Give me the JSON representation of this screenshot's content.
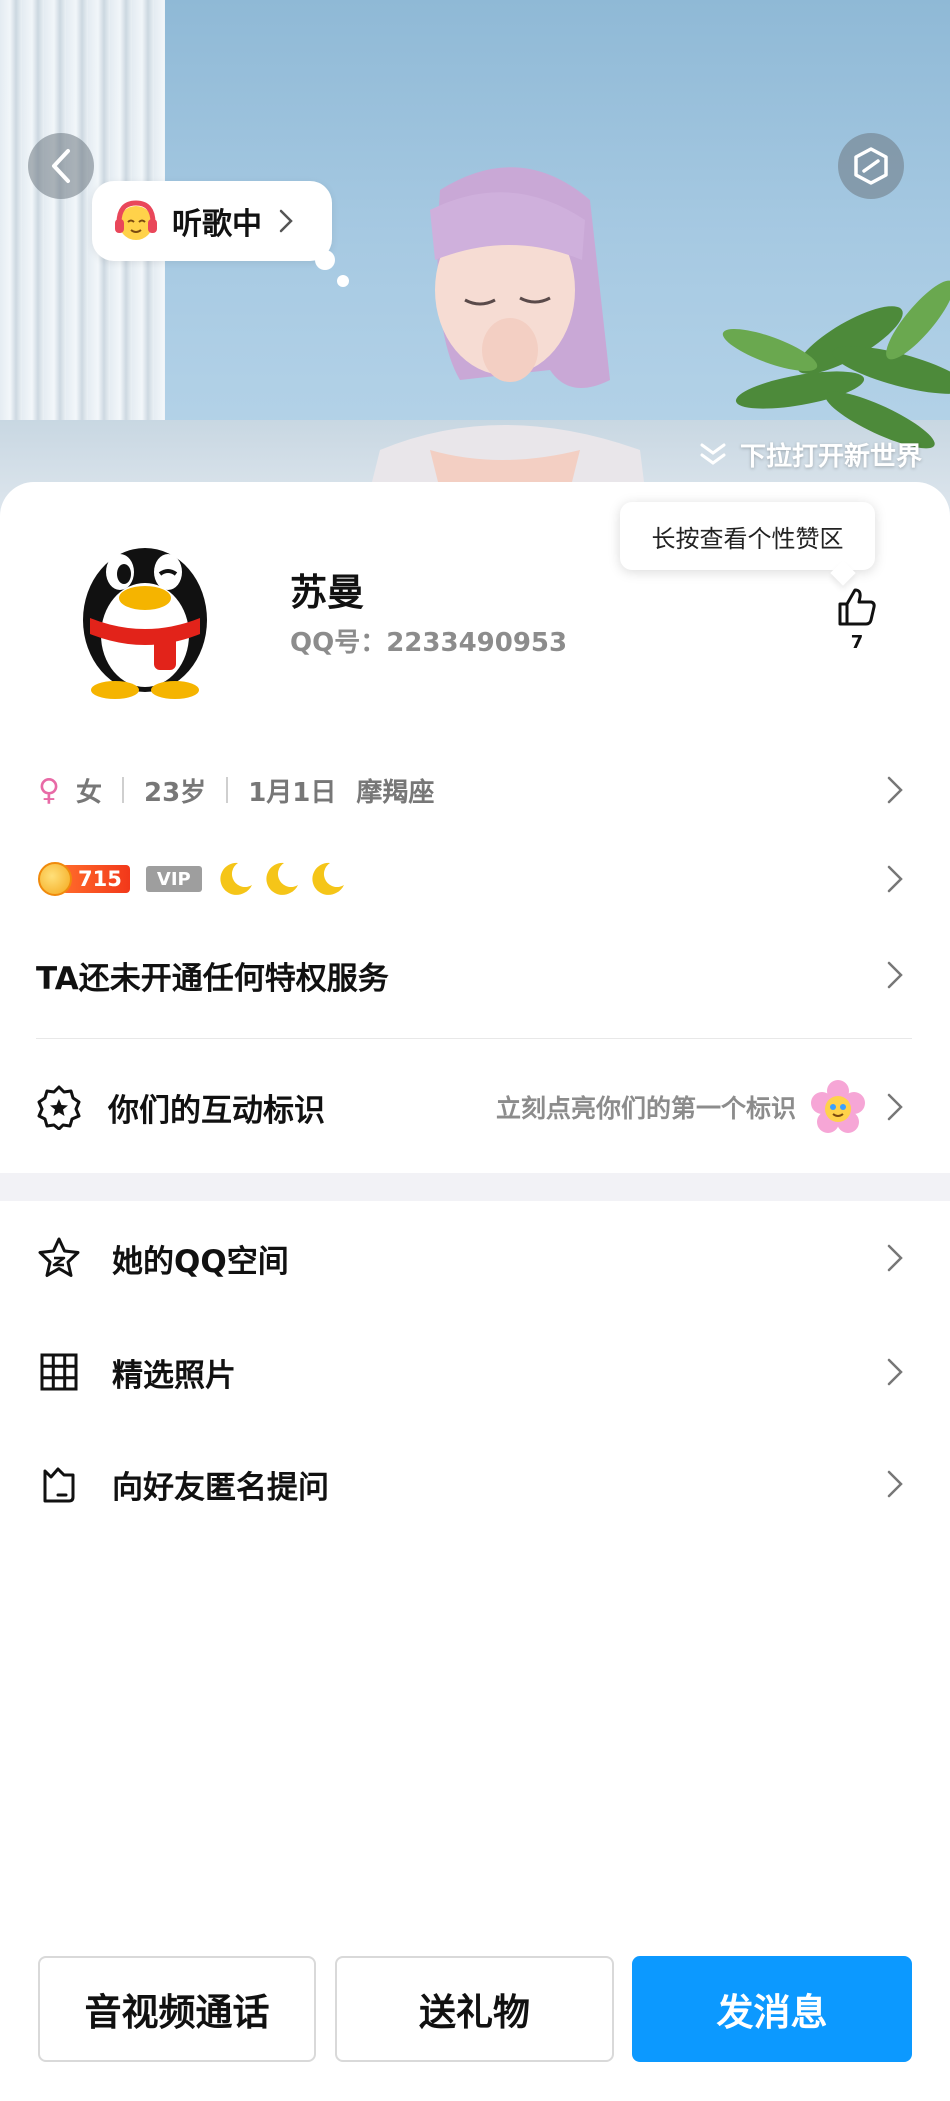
{
  "hero": {
    "status_bubble": "听歌中",
    "pull_hint": "下拉打开新世界"
  },
  "profile": {
    "nickname": "苏曼",
    "qq_number": "QQ号：2233490953",
    "like_tooltip": "长按查看个性赞区",
    "like_count": "7"
  },
  "info": {
    "gender_symbol": "♀",
    "gender": "女",
    "age": "23岁",
    "birthday": "1月1日",
    "zodiac": "摩羯座"
  },
  "badges": {
    "level": "715",
    "vip": "VIP",
    "moons": 3
  },
  "privilege": {
    "text": "TA还未开通任何特权服务"
  },
  "interaction": {
    "label": "你们的互动标识",
    "sub": "立刻点亮你们的第一个标识"
  },
  "menu": [
    {
      "label": "她的QQ空间",
      "icon": "star-icon"
    },
    {
      "label": "精选照片",
      "icon": "grid-icon"
    },
    {
      "label": "向好友匿名提问",
      "icon": "cat-box-icon"
    }
  ],
  "actions": {
    "call": "音视频通话",
    "gift": "送礼物",
    "message": "发消息"
  },
  "colors": {
    "primary": "#0c99ff",
    "gender_pink": "#e86aa6",
    "level_orange": "#f2381a"
  }
}
